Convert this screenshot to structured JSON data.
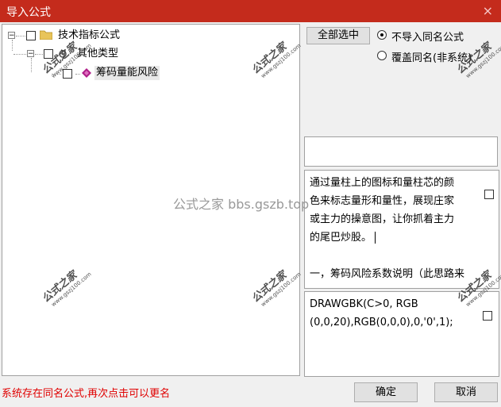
{
  "window": {
    "title": "导入公式",
    "close_glyph": "×"
  },
  "tree": {
    "root": {
      "label": "技术指标公式",
      "expander": "−"
    },
    "child": {
      "label": "其他类型",
      "expander": "−"
    },
    "leaf": {
      "label": "筹码量能风险"
    }
  },
  "options": {
    "select_all_label": "全部选中",
    "radio_1": {
      "label": "不导入同名公式",
      "selected": true
    },
    "radio_2": {
      "label": "覆盖同名(非系统)",
      "selected": false
    }
  },
  "description_panel": {
    "lines": [
      "通过量柱上的图标和量柱芯的颜",
      "色来标志量形和量性，展现庄家",
      "或主力的操意图，让你抓着主力",
      "的尾巴炒股。",
      "",
      "一，筹码风险系数说明（此思路来"
    ]
  },
  "code_panel": {
    "lines": [
      "DRAWGBK(C>0, RGB",
      "(0,0,20),RGB(0,0,0),0,'0',1);"
    ]
  },
  "status_message": "系统存在同名公式,再次点击可以更名",
  "buttons": {
    "ok": "确定",
    "cancel": "取消"
  },
  "watermarks": {
    "text_big": "公式之家",
    "text_small": "www.gszj100.com",
    "center_text": "公式之家 bbs.gszb.top"
  },
  "colors": {
    "titlebar": "#c42b1c",
    "status_text": "#e00000",
    "leaf_icon": "#b0208a"
  }
}
